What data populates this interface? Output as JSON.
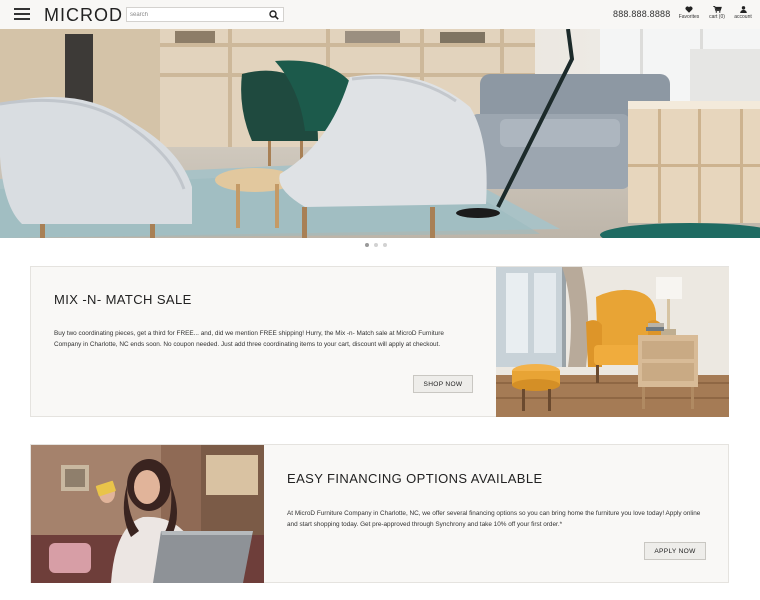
{
  "header": {
    "logo": "MICROD",
    "search_placeholder": "search",
    "phone": "888.888.8888",
    "favorites_label": "Favorites",
    "cart_label": "cart (0)",
    "account_label": "account"
  },
  "hero": {
    "slide_count": 3,
    "active_slide": 1
  },
  "promos": [
    {
      "title": "MIX -N- MATCH SALE",
      "body": "Buy two coordinating pieces, get a third for FREE... and, did we mention FREE shipping! Hurry, the Mix -n- Match sale at MicroD Furniture Company in Charlotte, NC ends soon. No coupon needed. Just add three coordinating items to your cart, discount will apply at checkout.",
      "button": "SHOP NOW"
    },
    {
      "title": "EASY FINANCING OPTIONS AVAILABLE",
      "body": "At MicroD Furniture Company in Charlotte, NC, we offer several financing options so you can bring home the furniture you love today! Apply online and start shopping today. Get pre-approved through Synchrony and take 10% off your first order.*",
      "button": "APPLY NOW"
    }
  ],
  "colors": {
    "header_bg": "#f8f7f5",
    "card_bg": "#f9f8f6",
    "button_bg": "#eeedea",
    "accent_chair": "#1f4a3f",
    "accent_armchair": "#e8a435"
  },
  "icons": [
    "menu-icon",
    "search-icon",
    "heart-icon",
    "cart-icon",
    "user-icon"
  ]
}
